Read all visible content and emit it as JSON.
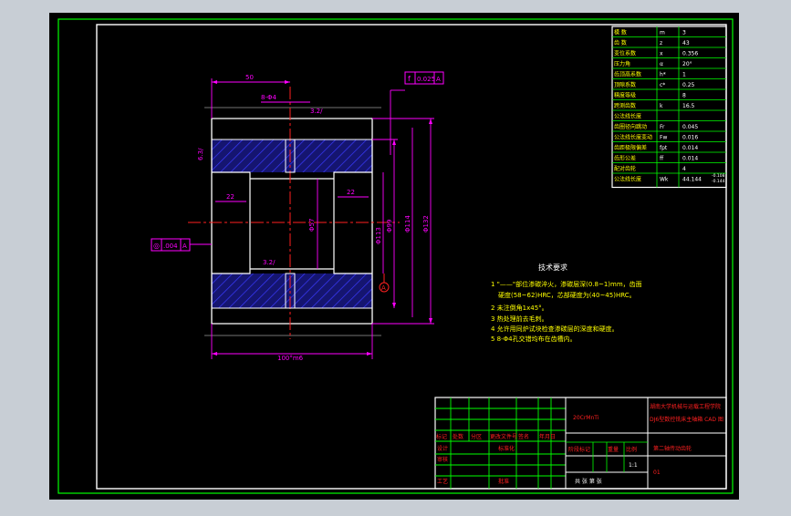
{
  "drawing": {
    "dims": {
      "width_50": "50",
      "holes": "8-Φ4",
      "length_100": "100°m6",
      "slot_22_left": "22",
      "slot_22_right": "22",
      "d57": "Φ57",
      "d113": "Φ113",
      "d99": "Φ99",
      "d114": "Φ114",
      "d132": "Φ132",
      "rough_top": "3.2/",
      "rough_mid": "3.2/",
      "rough_left": "6.3/"
    },
    "tol_top": {
      "sym": "f",
      "val": "0.025",
      "ref": "A"
    },
    "tol_left": {
      "sym": "◎",
      "val": ".004",
      "ref": "A"
    },
    "datum": "A"
  },
  "params": [
    {
      "name": "模  数",
      "sym": "m",
      "val": "3"
    },
    {
      "name": "齿  数",
      "sym": "z",
      "val": "43"
    },
    {
      "name": "变位系数",
      "sym": "x",
      "val": "0.356"
    },
    {
      "name": "压力角",
      "sym": "α",
      "val": "20°"
    },
    {
      "name": "齿顶高系数",
      "sym": "h*",
      "val": "1"
    },
    {
      "name": "顶隙系数",
      "sym": "c*",
      "val": "0.25"
    },
    {
      "name": "精度等级",
      "sym": "",
      "val": "8"
    },
    {
      "name": "跨测齿数",
      "sym": "k",
      "val": "16.5"
    },
    {
      "name": "公法线长度",
      "sym": "",
      "val": ""
    },
    {
      "name": "齿圈径向跳动",
      "sym": "Fr",
      "val": "0.045"
    },
    {
      "name": "公法线长度变动",
      "sym": "Fw",
      "val": "0.016"
    },
    {
      "name": "齿距极限偏差",
      "sym": "fpt",
      "val": "0.014"
    },
    {
      "name": "齿形公差",
      "sym": "ff",
      "val": "0.014"
    },
    {
      "name": "配对齿轮",
      "sym": "",
      "val": "4"
    },
    {
      "name": "公法线长度",
      "sym": "Wk",
      "val": "44.144",
      "tol_hi": "-0.108",
      "tol_lo": "-0.144"
    }
  ],
  "notes": {
    "title": "技术要求",
    "lines": [
      "1 \"——\"部位渗碳淬火，渗碳层深(0.8~1)mm，齿面",
      "硬度(58~62)HRC，芯部硬度为(40~45)HRC。",
      "2 未注倒角1x45°。",
      "3 热处理前去毛刺。",
      "4 允许用同炉试块检查渗碳层的深度和硬度。",
      "5 8-Φ4孔交错均布在齿槽内。"
    ]
  },
  "titleblock": {
    "material": "20CrMnTi",
    "company_line1": "湖南大学机械与运载工程学院",
    "company_line2": "DJ6型数控铣床主轴箱 CAD 图",
    "drawing_name": "第二轴传动齿轮",
    "drawing_no": "01",
    "rev_headers": [
      "标记",
      "处数",
      "分区",
      "更改文件号",
      "签名",
      "年月日"
    ],
    "design_label": "设计",
    "std_label": "标准化",
    "review_label": "审核",
    "craft_label": "工艺",
    "approve_label": "批准",
    "stage_headers": [
      "阶段标记",
      "重量",
      "比例"
    ],
    "scale": "1:1",
    "sheet": "共  张  第  张"
  },
  "colors": {
    "bg": "#000000",
    "frame": "#ffffff",
    "border": "#00ff00",
    "dim": "#ff00ff",
    "yellow": "#ffff00",
    "red": "#ff2020",
    "hatch": "#3a3aff",
    "outline": "#ffffff"
  }
}
